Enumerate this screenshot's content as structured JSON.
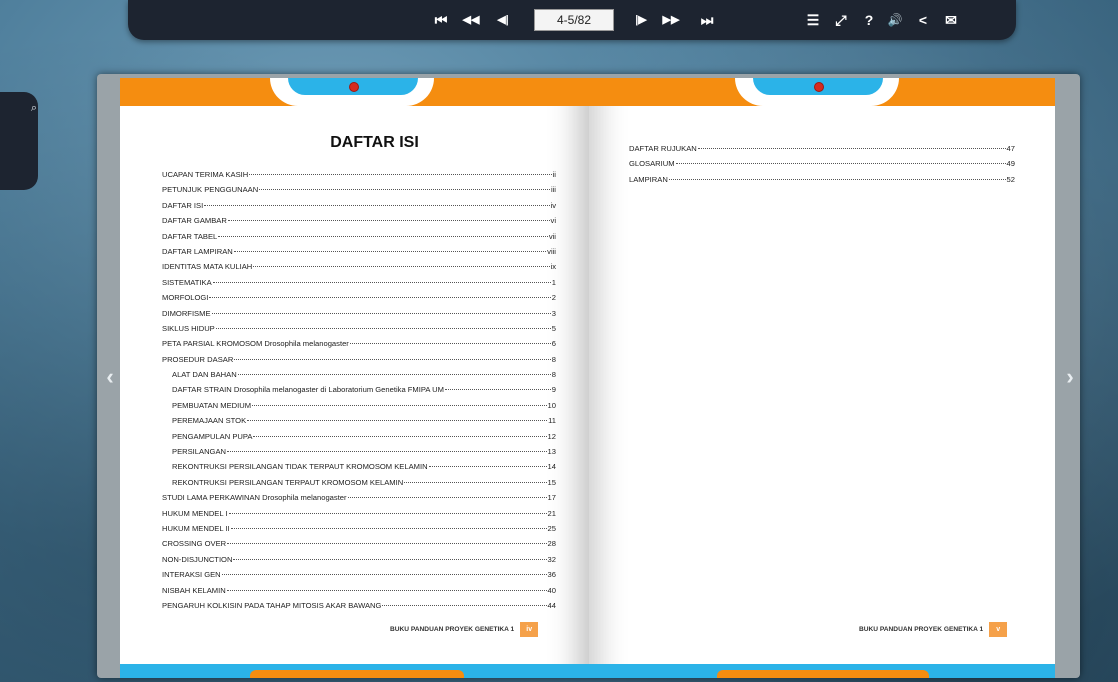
{
  "toolbar": {
    "page_value": "4-5/82",
    "buttons": {
      "first": "⏮",
      "prev_fast": "◀◀",
      "prev": "◀|",
      "next": "|▶",
      "next_fast": "▶▶",
      "last": "⏭",
      "toc": "☰",
      "fullscreen": "⤢",
      "help": "?",
      "sound": "🔊",
      "share": "<",
      "email": "✉"
    }
  },
  "side": {
    "search_icon": "⌕"
  },
  "nav": {
    "prev_arrow": "‹",
    "next_arrow": "›"
  },
  "left_page": {
    "title": "DAFTAR ISI",
    "entries": [
      {
        "label": "UCAPAN TERIMA KASIH",
        "page": "ii"
      },
      {
        "label": "PETUNJUK PENGGUNAAN",
        "page": "iii"
      },
      {
        "label": "DAFTAR ISI",
        "page": "iv"
      },
      {
        "label": "DAFTAR GAMBAR",
        "page": "vi"
      },
      {
        "label": "DAFTAR TABEL",
        "page": "vii"
      },
      {
        "label": "DAFTAR LAMPIRAN",
        "page": "viii"
      },
      {
        "label": "IDENTITAS MATA KULIAH",
        "page": "ix"
      },
      {
        "label": "SISTEMATIKA",
        "page": "1"
      },
      {
        "label": "MORFOLOGI",
        "page": "2"
      },
      {
        "label": "DIMORFISME",
        "page": "3"
      },
      {
        "label": "SIKLUS HIDUP",
        "page": "5"
      },
      {
        "label": "PETA PARSIAL KROMOSOM Drosophila melanogaster",
        "page": "6"
      },
      {
        "label": "PROSEDUR DASAR",
        "page": "8"
      },
      {
        "label": "ALAT DAN BAHAN",
        "page": "8",
        "indent": true
      },
      {
        "label": "DAFTAR STRAIN Drosophila melanogaster di Laboratorium Genetika FMIPA UM",
        "page": "9",
        "indent": true
      },
      {
        "label": "PEMBUATAN MEDIUM",
        "page": "10",
        "indent": true
      },
      {
        "label": "PEREMAJAAN STOK",
        "page": "11",
        "indent": true
      },
      {
        "label": "PENGAMPULAN PUPA",
        "page": "12",
        "indent": true
      },
      {
        "label": "PERSILANGAN",
        "page": "13",
        "indent": true
      },
      {
        "label": "REKONTRUKSI PERSILANGAN TIDAK TERPAUT KROMOSOM KELAMIN",
        "page": "14",
        "indent": true
      },
      {
        "label": "REKONTRUKSI PERSILANGAN TERPAUT KROMOSOM KELAMIN",
        "page": "15",
        "indent": true
      },
      {
        "label": "STUDI LAMA PERKAWINAN  Drosophila melanogaster",
        "page": "17"
      },
      {
        "label": "HUKUM MENDEL I",
        "page": "21"
      },
      {
        "label": "HUKUM MENDEL II",
        "page": "25"
      },
      {
        "label": "CROSSING OVER",
        "page": "28"
      },
      {
        "label": "NON-DISJUNCTION",
        "page": "32"
      },
      {
        "label": "INTERAKSI GEN",
        "page": "36"
      },
      {
        "label": "NISBAH KELAMIN",
        "page": "40"
      },
      {
        "label": "PENGARUH KOLKISIN PADA TAHAP MITOSIS AKAR BAWANG",
        "page": "44"
      }
    ],
    "footer_text": "BUKU PANDUAN PROYEK GENETIKA 1",
    "footer_page": "iv"
  },
  "right_page": {
    "entries": [
      {
        "label": "DAFTAR RUJUKAN",
        "page": "47"
      },
      {
        "label": "GLOSARIUM",
        "page": "49"
      },
      {
        "label": "LAMPIRAN",
        "page": "52"
      }
    ],
    "footer_text": "BUKU PANDUAN PROYEK GENETIKA 1",
    "footer_page": "v"
  },
  "colors": {
    "accent_orange": "#f58d10",
    "accent_blue": "#2bb3e8",
    "toolbar_bg": "#1d2430"
  }
}
